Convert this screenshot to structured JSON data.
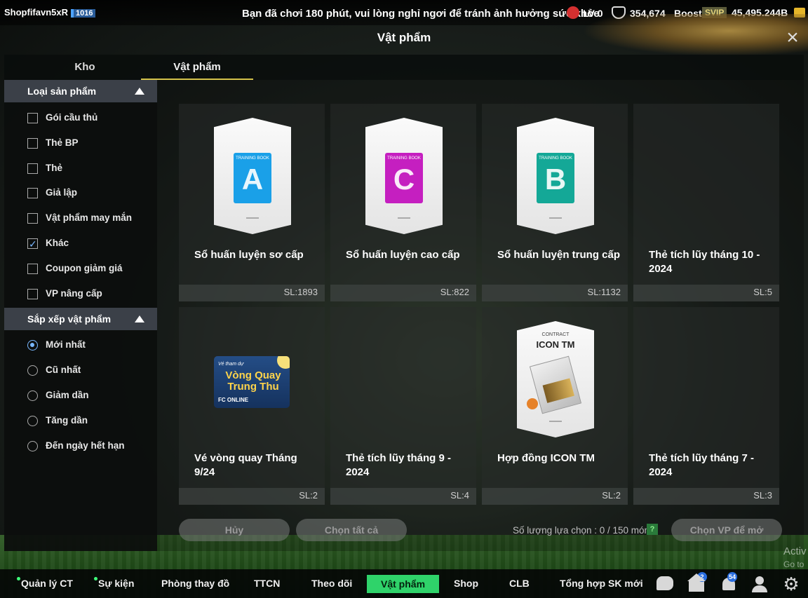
{
  "topbar": {
    "player_name": "Shopfifavn5xR",
    "player_level": "1016",
    "warning": "Bạn đã chơi 180 phút, vui lòng nghỉ ngơi để tránh ảnh hưởng sức khỏe",
    "lv": "LV 0",
    "coins": "354,674",
    "boost": "Boost",
    "svip": "SVIP",
    "bp": "45,495.244B"
  },
  "title": "Vật phẩm",
  "close_label": "×",
  "tabs": [
    {
      "label": "Kho",
      "active": false
    },
    {
      "label": "Vật phẩm",
      "active": true
    }
  ],
  "filter": {
    "category_header": "Loại sản phẩm",
    "categories": [
      {
        "label": "Gói cầu thủ",
        "checked": false
      },
      {
        "label": "Thẻ BP",
        "checked": false
      },
      {
        "label": "Thẻ",
        "checked": false
      },
      {
        "label": "Giả lập",
        "checked": false
      },
      {
        "label": "Vật phẩm may mắn",
        "checked": false
      },
      {
        "label": "Khác",
        "checked": true
      },
      {
        "label": "Coupon giảm giá",
        "checked": false
      },
      {
        "label": "VP nâng cấp",
        "checked": false
      }
    ],
    "sort_header": "Sắp xếp vật phẩm",
    "sorts": [
      {
        "label": "Mới nhất",
        "selected": true
      },
      {
        "label": "Cũ nhất",
        "selected": false
      },
      {
        "label": "Giảm dần",
        "selected": false
      },
      {
        "label": "Tăng dần",
        "selected": false
      },
      {
        "label": "Đến ngày hết hạn",
        "selected": false
      }
    ]
  },
  "items": [
    {
      "name": "Sổ huấn luyện sơ cấp",
      "qty": "SL:1893",
      "art": "book",
      "book_letter": "A",
      "book_text": "TRAINING BOOK",
      "color": "#1aa0e8"
    },
    {
      "name": "Sổ huấn luyện cao cấp",
      "qty": "SL:822",
      "art": "book",
      "book_letter": "C",
      "book_text": "TRAINING BOOK",
      "color": "#c51fc0"
    },
    {
      "name": "Sổ huấn luyện trung cấp",
      "qty": "SL:1132",
      "art": "book",
      "book_letter": "B",
      "book_text": "TRAINING BOOK",
      "color": "#14a897"
    },
    {
      "name": "Thẻ tích lũy tháng 10 - 2024",
      "qty": "SL:5",
      "art": "none"
    },
    {
      "name": "Vé vòng quay Tháng 9/24",
      "qty": "SL:2",
      "art": "ticket",
      "ticket_small": "Vé tham dự",
      "ticket_big": "Vòng Quay Trung Thu",
      "ticket_brand": "FC ONLINE"
    },
    {
      "name": "Thẻ tích lũy tháng 9 - 2024",
      "qty": "SL:4",
      "art": "none"
    },
    {
      "name": "Hợp đồng ICON TM",
      "qty": "SL:2",
      "art": "contract",
      "contract_top": "CONTRACT",
      "contract_title": "ICON TM"
    },
    {
      "name": "Thẻ tích lũy tháng 7 - 2024",
      "qty": "SL:3",
      "art": "none"
    }
  ],
  "actions": {
    "cancel": "Hủy",
    "select_all": "Chọn tất cả",
    "selection_count": "Số lượng lựa chọn : 0 / 150 món",
    "help": "?",
    "open": "Chọn VP để mở"
  },
  "watermark": {
    "line1": "Activ",
    "line2": "Go to"
  },
  "nav": [
    {
      "label": "Quản lý CT",
      "dot": true
    },
    {
      "label": "Sự kiện",
      "dot": true
    },
    {
      "label": "Phòng thay đồ",
      "dot": false
    },
    {
      "label": "TTCN",
      "dot": false
    },
    {
      "label": "Theo dõi",
      "dot": false
    },
    {
      "label": "Vật phẩm",
      "dot": false,
      "active": true
    },
    {
      "label": "Shop",
      "dot": false
    },
    {
      "label": "CLB",
      "dot": false
    },
    {
      "label": "Tổng hợp SK mới",
      "dot": false
    }
  ],
  "nav_icons": [
    {
      "icon": "chat-icon"
    },
    {
      "icon": "home-icon",
      "badge": "2"
    },
    {
      "icon": "bell-icon",
      "badge": "54"
    },
    {
      "icon": "user-icon"
    },
    {
      "icon": "gear-icon"
    }
  ]
}
